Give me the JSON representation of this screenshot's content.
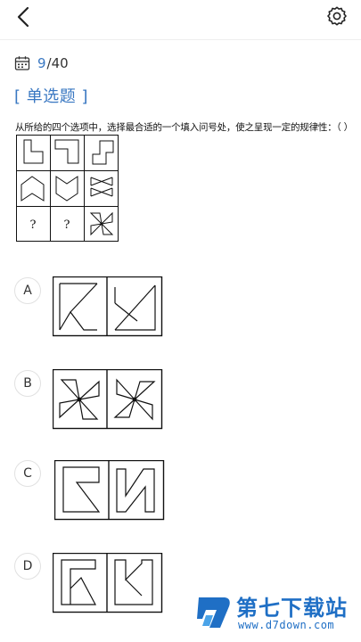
{
  "progress": {
    "current": "9",
    "separator": "/",
    "total": " 40"
  },
  "question": {
    "type_label": "[ 单选题 ]",
    "text": "从所给的四个选项中，选择最合适的一个填入问号处，使之呈现一定的规律性：（ ）",
    "grid_question_marks": [
      "?",
      "?"
    ]
  },
  "options": [
    {
      "letter": "A"
    },
    {
      "letter": "B"
    },
    {
      "letter": "C"
    },
    {
      "letter": "D"
    }
  ],
  "watermark": {
    "brand": "第七下载站",
    "url": "www.d7down.com"
  },
  "colors": {
    "accent": "#3a78c2",
    "brand": "#1f6fc5"
  },
  "icons": [
    "back-arrow-icon",
    "settings-gear-icon",
    "calendar-icon"
  ]
}
